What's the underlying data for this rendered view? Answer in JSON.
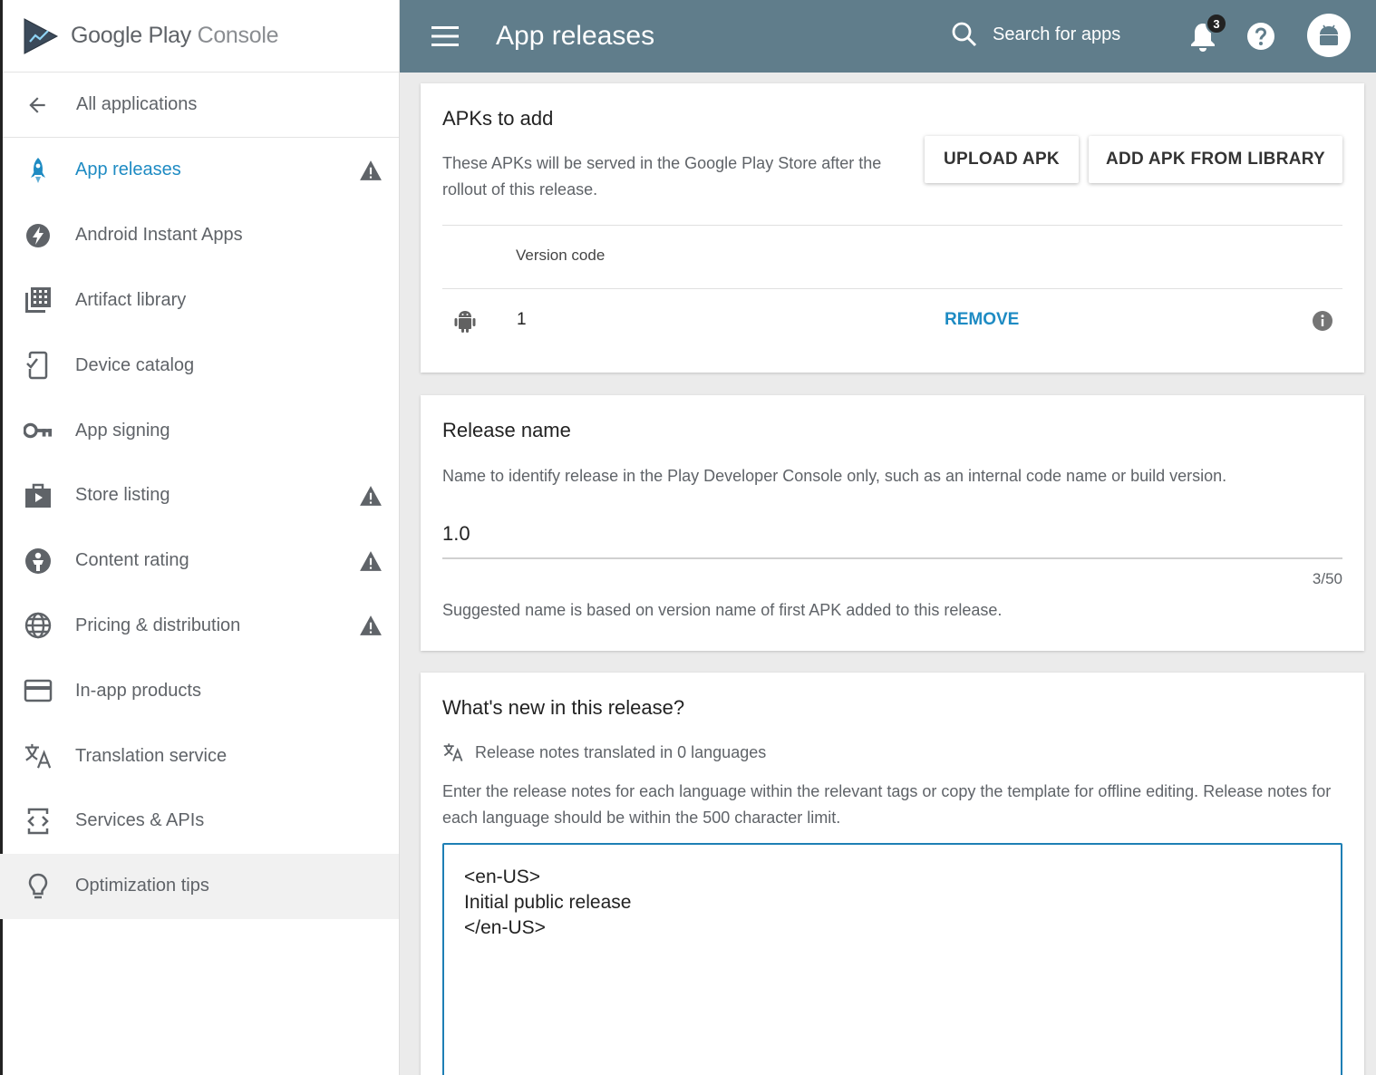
{
  "brand": {
    "name_main": "Google Play",
    "name_sub": "Console"
  },
  "sidebar": {
    "back_label": "All applications",
    "items": [
      {
        "label": "App releases",
        "icon": "rocket-icon",
        "warning": true,
        "active": true
      },
      {
        "label": "Android Instant Apps",
        "icon": "bolt-icon",
        "warning": false
      },
      {
        "label": "Artifact library",
        "icon": "library-icon",
        "warning": false
      },
      {
        "label": "Device catalog",
        "icon": "device-catalog-icon",
        "warning": false
      },
      {
        "label": "App signing",
        "icon": "key-icon",
        "warning": false
      },
      {
        "label": "Store listing",
        "icon": "store-listing-icon",
        "warning": true
      },
      {
        "label": "Content rating",
        "icon": "content-rating-icon",
        "warning": true
      },
      {
        "label": "Pricing & distribution",
        "icon": "globe-icon",
        "warning": true
      },
      {
        "label": "In-app products",
        "icon": "credit-card-icon",
        "warning": false
      },
      {
        "label": "Translation service",
        "icon": "translate-icon",
        "warning": false
      },
      {
        "label": "Services & APIs",
        "icon": "api-icon",
        "warning": false
      },
      {
        "label": "Optimization tips",
        "icon": "lightbulb-icon",
        "warning": false
      }
    ]
  },
  "header": {
    "title": "App releases",
    "search_placeholder": "Search for apps",
    "notification_count": "3"
  },
  "apks": {
    "title": "APKs to add",
    "description": "These APKs will be served in the Google Play Store after the rollout of this release.",
    "upload_label": "UPLOAD APK",
    "library_label": "ADD APK FROM LIBRARY",
    "column_header": "Version code",
    "rows": [
      {
        "version_code": "1",
        "action": "REMOVE"
      }
    ]
  },
  "release_name": {
    "title": "Release name",
    "description": "Name to identify release in the Play Developer Console only, such as an internal code name or build version.",
    "value": "1.0",
    "counter": "3/50",
    "hint": "Suggested name is based on version name of first APK added to this release."
  },
  "whats_new": {
    "title": "What's new in this release?",
    "translated_note": "Release notes translated in 0 languages",
    "description": "Enter the release notes for each language within the relevant tags or copy the template for offline editing. Release notes for each language should be within the 500 character limit.",
    "notes": "<en-US>\nInitial public release\n</en-US>"
  },
  "colors": {
    "topbar": "#607d8b",
    "accent": "#1e8bc3",
    "focus": "#1e7fb5"
  }
}
